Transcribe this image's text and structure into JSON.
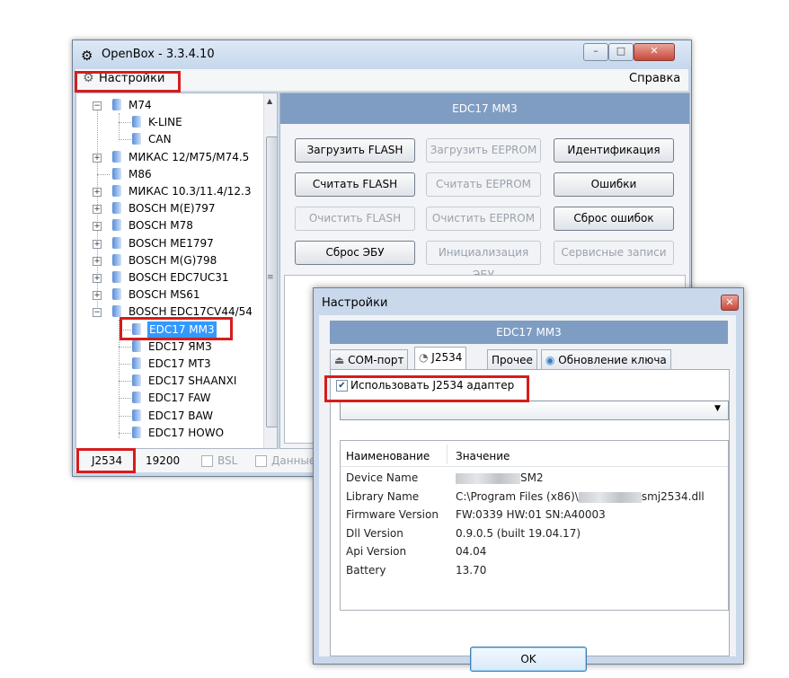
{
  "app": {
    "title": "OpenBox - 3.3.4.10",
    "menu_settings": "Настройки",
    "menu_help": "Справка",
    "window_controls": {
      "minimize": "–",
      "maximize": "□",
      "close": "✕"
    }
  },
  "tree": {
    "items": [
      {
        "label": "M74"
      },
      {
        "label": "K-LINE"
      },
      {
        "label": "CAN"
      },
      {
        "label": "МИКАС 12/M75/M74.5"
      },
      {
        "label": "M86"
      },
      {
        "label": "МИКАС 10.3/11.4/12.3"
      },
      {
        "label": "BOSCH M(E)797"
      },
      {
        "label": "BOSCH M78"
      },
      {
        "label": "BOSCH ME1797"
      },
      {
        "label": "BOSCH M(G)798"
      },
      {
        "label": "BOSCH EDC7UC31"
      },
      {
        "label": "BOSCH MS61"
      },
      {
        "label": "BOSCH EDC17CV44/54"
      },
      {
        "label": "EDC17 MM3"
      },
      {
        "label": "EDC17 ЯМЗ"
      },
      {
        "label": "EDC17 MT3"
      },
      {
        "label": "EDC17 SHAANXI"
      },
      {
        "label": "EDC17 FAW"
      },
      {
        "label": "EDC17 BAW"
      },
      {
        "label": "EDC17 HOWO"
      }
    ]
  },
  "panel": {
    "header": "EDC17 MM3",
    "buttons": [
      {
        "label": "Загрузить FLASH"
      },
      {
        "label": "Загрузить EEPROM"
      },
      {
        "label": "Идентификация"
      },
      {
        "label": "Считать FLASH"
      },
      {
        "label": "Считать EEPROM"
      },
      {
        "label": "Ошибки"
      },
      {
        "label": "Очистить FLASH"
      },
      {
        "label": "Очистить EEPROM"
      },
      {
        "label": "Сброс ошибок"
      },
      {
        "label": "Сброс ЭБУ"
      },
      {
        "label": "Инициализация ЭБУ"
      },
      {
        "label": "Сервисные записи"
      }
    ]
  },
  "status": {
    "adapter": "J2534",
    "baud": "19200",
    "bsl": "BSL",
    "data": "Данные"
  },
  "dialog": {
    "title": "Настройки",
    "close": "✕",
    "header": "EDC17 MM3",
    "tabs": [
      {
        "label": "COM-порт"
      },
      {
        "label": "J2534"
      },
      {
        "label": "Прочее"
      },
      {
        "label": "Обновление ключа"
      }
    ],
    "use_adapter": "Использовать J2534 адаптер",
    "combo_value": "",
    "grid": {
      "col_name": "Наименование",
      "col_value": "Значение",
      "rows": [
        {
          "name": "Device Name",
          "value": "SM2"
        },
        {
          "name": "Library Name",
          "value_prefix": "C:\\Program Files (x86)\\",
          "value": "smj2534.dll"
        },
        {
          "name": "Firmware Version",
          "value": "FW:0339 HW:01 SN:A40003"
        },
        {
          "name": "Dll Version",
          "value": "0.9.0.5 (built 19.04.17)"
        },
        {
          "name": "Api Version",
          "value": "04.04"
        },
        {
          "name": "Battery",
          "value": "13.70"
        }
      ]
    },
    "ok": "OK"
  },
  "colors": {
    "highlight": "#d71c1c",
    "header": "#7f9dc3",
    "selection": "#3399ff"
  }
}
